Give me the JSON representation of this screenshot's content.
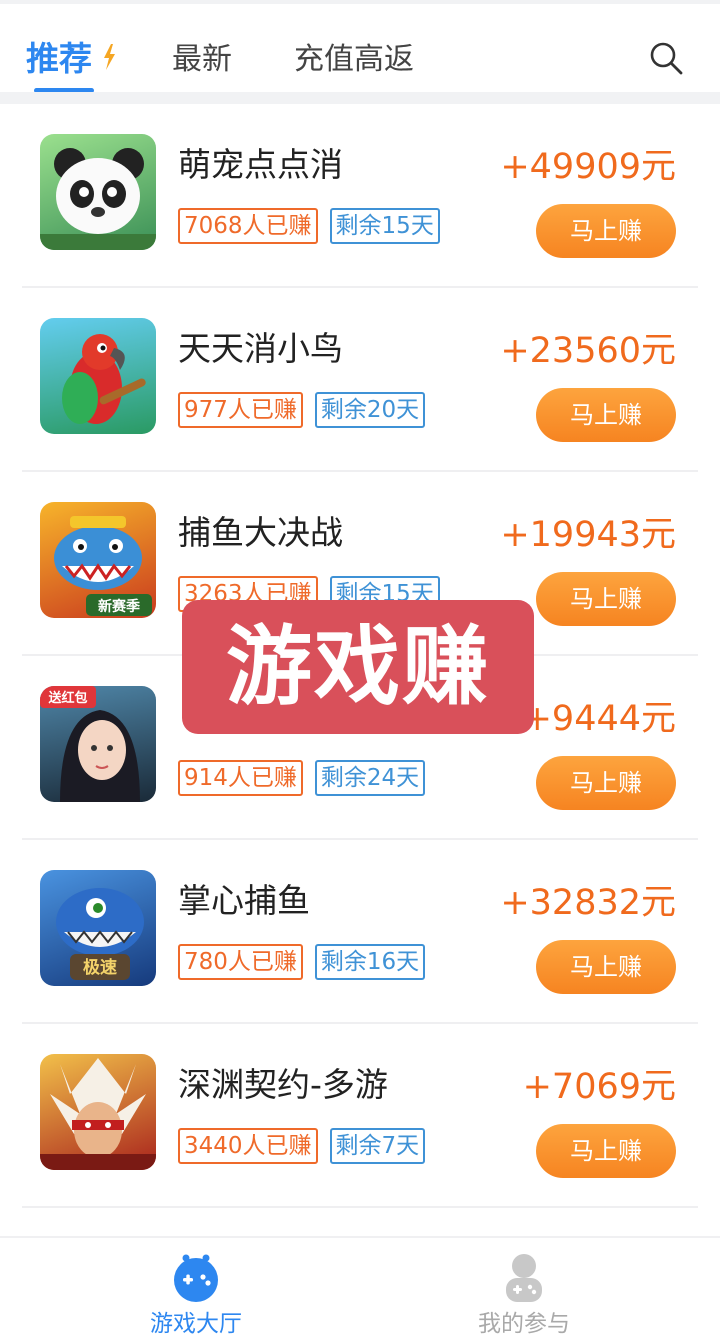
{
  "tabs": [
    {
      "label": "推荐",
      "active": true
    },
    {
      "label": "最新",
      "active": false
    },
    {
      "label": "充值高返",
      "active": false
    }
  ],
  "overlay_label": "游戏赚",
  "games": [
    {
      "name": "萌宠点点消",
      "reward": "+49909元",
      "earned": "7068人已赚",
      "remaining": "剩余15天",
      "button": "马上赚",
      "thumb_icon": "panda-game-icon",
      "thumb_colors": [
        "#7fcf7a",
        "#3a8f56"
      ]
    },
    {
      "name": "天天消小鸟",
      "reward": "+23560元",
      "earned": "977人已赚",
      "remaining": "剩余20天",
      "button": "马上赚",
      "thumb_icon": "parrot-game-icon",
      "thumb_colors": [
        "#4fc0e6",
        "#1f8e5c"
      ]
    },
    {
      "name": "捕鱼大决战",
      "reward": "+19943元",
      "earned": "3263人已赚",
      "remaining": "剩余15天",
      "button": "马上赚",
      "thumb_icon": "shark-game-icon",
      "thumb_colors": [
        "#f2a219",
        "#c2321e"
      ],
      "badge": "新赛季"
    },
    {
      "name": "",
      "reward": "+9444元",
      "earned": "914人已赚",
      "remaining": "剩余24天",
      "button": "马上赚",
      "thumb_icon": "heroine-game-icon",
      "thumb_colors": [
        "#3c6f8f",
        "#1c2b3a"
      ],
      "badge": "送红包"
    },
    {
      "name": "掌心捕鱼",
      "reward": "+32832元",
      "earned": "780人已赚",
      "remaining": "剩余16天",
      "button": "马上赚",
      "thumb_icon": "blue-shark-game-icon",
      "thumb_colors": [
        "#3d86d8",
        "#1b3f86"
      ],
      "badge": "极速"
    },
    {
      "name": "深渊契约-多游",
      "reward": "+7069元",
      "earned": "3440人已赚",
      "remaining": "剩余7天",
      "button": "马上赚",
      "thumb_icon": "warrior-game-icon",
      "thumb_colors": [
        "#f0b43c",
        "#b3261e"
      ]
    }
  ],
  "bottom_nav": [
    {
      "label": "游戏大厅",
      "active": true,
      "icon": "gamepad-icon"
    },
    {
      "label": "我的参与",
      "active": false,
      "icon": "user-gamepad-icon"
    }
  ],
  "colors": {
    "accent": "#2d87f0",
    "reward": "#f06a1d",
    "button": "#f68421",
    "overlay": "#d9505a"
  }
}
